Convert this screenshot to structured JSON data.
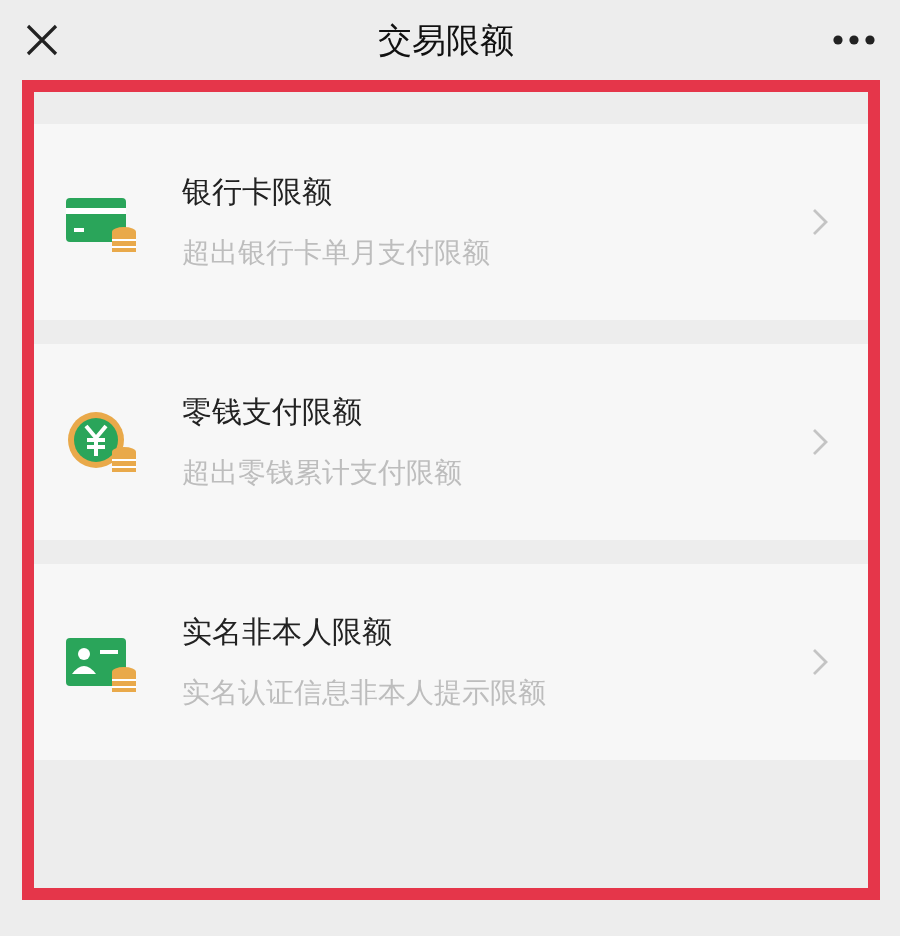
{
  "header": {
    "title": "交易限额"
  },
  "items": [
    {
      "kind": "card",
      "title": "银行卡限额",
      "subtitle": "超出银行卡单月支付限额"
    },
    {
      "kind": "coin",
      "title": "零钱支付限额",
      "subtitle": "超出零钱累计支付限额"
    },
    {
      "kind": "id",
      "title": "实名非本人限额",
      "subtitle": "实名认证信息非本人提示限额"
    }
  ]
}
